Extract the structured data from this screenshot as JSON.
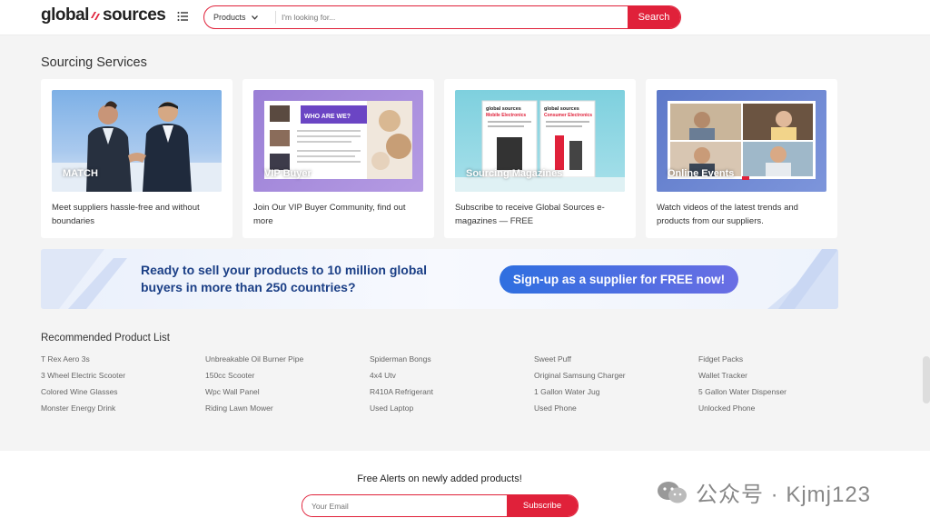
{
  "header": {
    "logo_left": "global",
    "logo_right": "sources",
    "category": "Products",
    "search_placeholder": "I'm looking for...",
    "search_button": "Search"
  },
  "sourcing": {
    "title": "Sourcing Services",
    "cards": [
      {
        "label": "MATCH",
        "desc": "Meet suppliers hassle-free and without boundaries"
      },
      {
        "label": "VIP Buyer",
        "desc": "Join Our VIP Buyer Community, find out more",
        "panel_title": "WHO ARE WE?"
      },
      {
        "label": "Sourcing Magazines",
        "desc": "Subscribe to receive Global Sources e-magazines — FREE",
        "mag1": "Mobile Electronics",
        "mag2": "Consumer Electronics"
      },
      {
        "label": "Online Events",
        "desc": "Watch videos of the latest trends and products from our suppliers."
      }
    ]
  },
  "banner": {
    "text": "Ready to sell your products to 10 million global buyers in more than 250 countries?",
    "cta": "Sign-up as a supplier for FREE now!"
  },
  "recommended": {
    "title": "Recommended Product List",
    "items": [
      "T Rex Aero 3s",
      "Unbreakable Oil Burner Pipe",
      "Spiderman Bongs",
      "Sweet Puff",
      "Fidget Packs",
      "3 Wheel Electric Scooter",
      "150cc Scooter",
      "4x4 Utv",
      "Original Samsung Charger",
      "Wallet Tracker",
      "Colored Wine Glasses",
      "Wpc Wall Panel",
      "R410A Refrigerant",
      "1 Gallon Water Jug",
      "5 Gallon Water Dispenser",
      "Monster Energy Drink",
      "Riding Lawn Mower",
      "Used Laptop",
      "Used Phone",
      "Unlocked Phone"
    ]
  },
  "alerts": {
    "title": "Free Alerts on newly added products!",
    "email_placeholder": "Your Email",
    "subscribe": "Subscribe"
  },
  "watermark": "公众号 · Kjmj123",
  "colors": {
    "brand_red": "#e0213a",
    "banner_text": "#1b3f86",
    "cta_blue": "#2f6fe0"
  }
}
